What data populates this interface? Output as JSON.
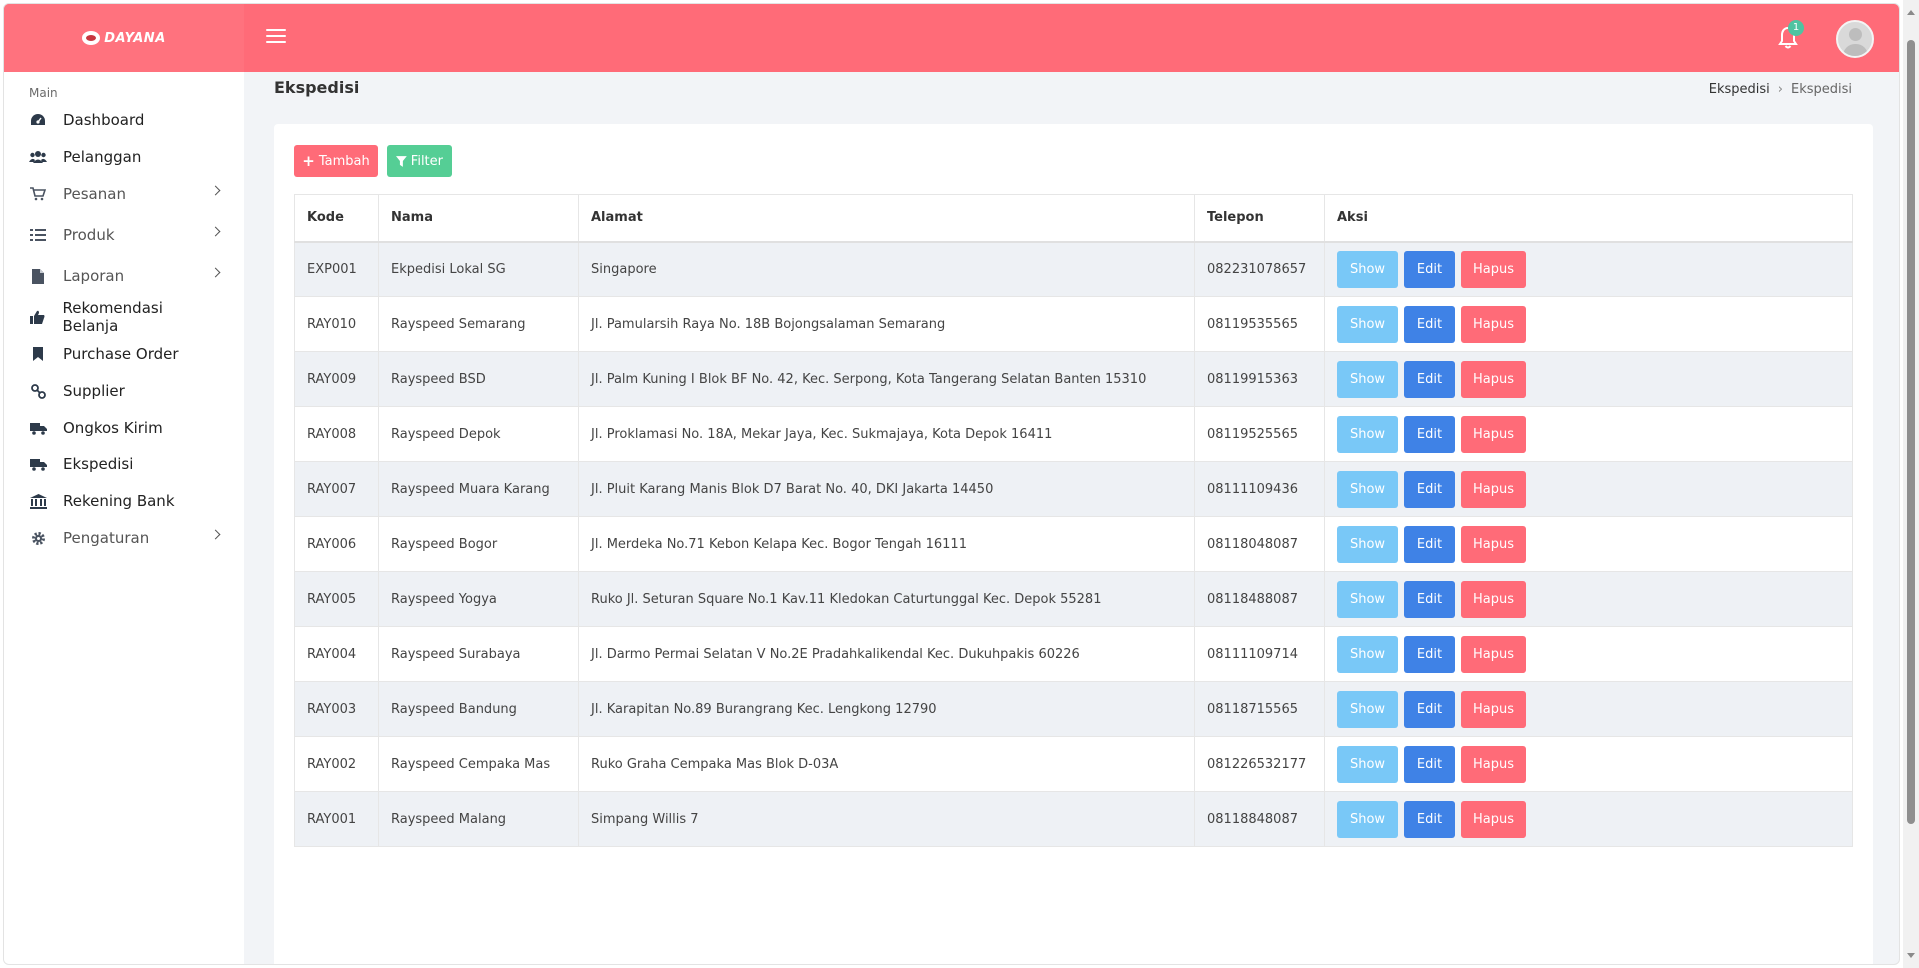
{
  "brand": {
    "logo_text": "DAYANA"
  },
  "header": {
    "notification_count": "1"
  },
  "sidebar": {
    "heading": "Main",
    "items": [
      {
        "label": "Dashboard",
        "icon": "palette-icon",
        "has_children": false
      },
      {
        "label": "Pelanggan",
        "icon": "users-icon",
        "has_children": false
      },
      {
        "label": "Pesanan",
        "icon": "cart-icon",
        "has_children": true
      },
      {
        "label": "Produk",
        "icon": "list-icon",
        "has_children": true
      },
      {
        "label": "Laporan",
        "icon": "file-icon",
        "has_children": true
      },
      {
        "label": "Rekomendasi Belanja",
        "icon": "thumbs-up-icon",
        "has_children": false
      },
      {
        "label": "Purchase Order",
        "icon": "bookmark-icon",
        "has_children": false
      },
      {
        "label": "Supplier",
        "icon": "link-icon",
        "has_children": false
      },
      {
        "label": "Ongkos Kirim",
        "icon": "truck-icon",
        "has_children": false
      },
      {
        "label": "Ekspedisi",
        "icon": "truck-icon",
        "has_children": false
      },
      {
        "label": "Rekening Bank",
        "icon": "bank-icon",
        "has_children": false
      },
      {
        "label": "Pengaturan",
        "icon": "gear-icon",
        "has_children": true
      }
    ]
  },
  "page": {
    "title": "Ekspedisi",
    "breadcrumb": [
      "Ekspedisi",
      "Ekspedisi"
    ]
  },
  "toolbar": {
    "add_label": "Tambah",
    "filter_label": "Filter"
  },
  "table": {
    "columns": [
      "Kode",
      "Nama",
      "Alamat",
      "Telepon",
      "Aksi"
    ],
    "action_labels": {
      "show": "Show",
      "edit": "Edit",
      "delete": "Hapus"
    },
    "rows": [
      {
        "kode": "EXP001",
        "nama": "Ekpedisi Lokal SG",
        "alamat": "Singapore",
        "telepon": "082231078657"
      },
      {
        "kode": "RAY010",
        "nama": "Rayspeed Semarang",
        "alamat": "Jl. Pamularsih Raya No. 18B Bojongsalaman Semarang",
        "telepon": "08119535565"
      },
      {
        "kode": "RAY009",
        "nama": "Rayspeed BSD",
        "alamat": "Jl. Palm Kuning I Blok BF No. 42, Kec. Serpong, Kota Tangerang Selatan Banten 15310",
        "telepon": "08119915363"
      },
      {
        "kode": "RAY008",
        "nama": "Rayspeed Depok",
        "alamat": "Jl. Proklamasi No. 18A, Mekar Jaya, Kec. Sukmajaya, Kota Depok 16411",
        "telepon": "08119525565"
      },
      {
        "kode": "RAY007",
        "nama": "Rayspeed Muara Karang",
        "alamat": "Jl. Pluit Karang Manis Blok D7 Barat No. 40, DKI Jakarta 14450",
        "telepon": "08111109436"
      },
      {
        "kode": "RAY006",
        "nama": "Rayspeed Bogor",
        "alamat": "Jl. Merdeka No.71 Kebon Kelapa Kec. Bogor Tengah 16111",
        "telepon": "08118048087"
      },
      {
        "kode": "RAY005",
        "nama": "Rayspeed Yogya",
        "alamat": "Ruko Jl. Seturan Square No.1 Kav.11 Kledokan Caturtunggal Kec. Depok 55281",
        "telepon": "08118488087"
      },
      {
        "kode": "RAY004",
        "nama": "Rayspeed Surabaya",
        "alamat": "Jl. Darmo Permai Selatan V No.2E Pradahkalikendal Kec. Dukuhpakis 60226",
        "telepon": "08111109714"
      },
      {
        "kode": "RAY003",
        "nama": "Rayspeed Bandung",
        "alamat": "Jl. Karapitan No.89 Burangrang Kec. Lengkong 12790",
        "telepon": "08118715565"
      },
      {
        "kode": "RAY002",
        "nama": "Rayspeed Cempaka Mas",
        "alamat": "Ruko Graha Cempaka Mas Blok D-03A",
        "telepon": "081226532177"
      },
      {
        "kode": "RAY001",
        "nama": "Rayspeed Malang",
        "alamat": "Simpang Willis 7",
        "telepon": "08118848087"
      }
    ]
  },
  "colors": {
    "header": "#ff6b78",
    "show": "#79c8f7",
    "edit": "#3f82e6",
    "delete": "#ff6b78",
    "filter": "#55ce95",
    "badge": "#4fc3a1"
  }
}
